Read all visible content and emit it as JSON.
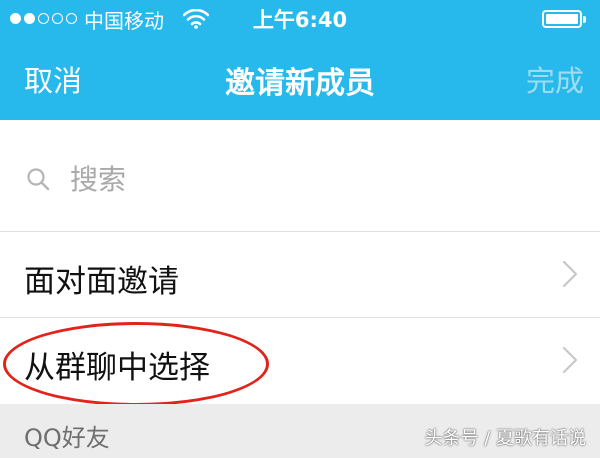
{
  "status_bar": {
    "carrier": "中国移动",
    "time": "上午6:40",
    "signal_strength": 2,
    "signal_max": 5
  },
  "nav": {
    "cancel_label": "取消",
    "title": "邀请新成员",
    "done_label": "完成"
  },
  "search": {
    "placeholder": "搜索"
  },
  "menu": {
    "items": [
      {
        "label": "面对面邀请",
        "icon": "chevron-right-icon"
      },
      {
        "label": "从群聊中选择",
        "icon": "chevron-right-icon"
      }
    ]
  },
  "section": {
    "header": "QQ好友"
  },
  "watermark": "头条号 / 夏歌有话说",
  "colors": {
    "header_bg": "#27b9ec",
    "done_disabled": "#9fdcf3",
    "highlight_ring": "#e2231a",
    "section_bg": "#ececec"
  }
}
